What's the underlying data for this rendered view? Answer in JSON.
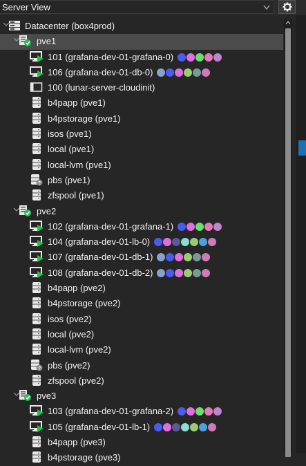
{
  "header": {
    "view_label": "Server View"
  },
  "tree": [
    {
      "label": "Datacenter (box4prod)",
      "icon": "datacenter-icon",
      "level": 0,
      "toggle": true,
      "selected": false
    },
    {
      "label": "pve1",
      "icon": "node-online-icon",
      "level": 1,
      "toggle": true,
      "selected": true
    },
    {
      "label": "101 (grafana-dev-01-grafana-0)",
      "icon": "vm-running-icon",
      "level": 2,
      "tags": [
        "#4a5cf0",
        "#e06ee0",
        "#6ae06a",
        "#e07ab8",
        "#c083d0"
      ]
    },
    {
      "label": "106 (grafana-dev-01-db-0)",
      "icon": "vm-running-icon",
      "level": 2,
      "tags": [
        "#8aa0d0",
        "#4a5cf0",
        "#e06ee0",
        "#9acd72",
        "#7a9a98",
        "#d27ab8"
      ]
    },
    {
      "label": "100 (lunar-server-cloudinit)",
      "icon": "template-icon",
      "level": 2
    },
    {
      "label": "b4papp (pve1)",
      "icon": "storage-icon",
      "level": 2
    },
    {
      "label": "b4pstorage (pve1)",
      "icon": "storage-icon",
      "level": 2
    },
    {
      "label": "isos (pve1)",
      "icon": "storage-icon",
      "level": 2
    },
    {
      "label": "local (pve1)",
      "icon": "storage-icon",
      "level": 2
    },
    {
      "label": "local-lvm (pve1)",
      "icon": "storage-icon",
      "level": 2
    },
    {
      "label": "pbs (pve1)",
      "icon": "storage-unknown-icon",
      "level": 2
    },
    {
      "label": "zfspool (pve1)",
      "icon": "storage-icon",
      "level": 2
    },
    {
      "label": "pve2",
      "icon": "node-online-icon",
      "level": 1,
      "toggle": true,
      "selected": false
    },
    {
      "label": "102 (grafana-dev-01-grafana-1)",
      "icon": "vm-running-icon",
      "level": 2,
      "tags": [
        "#4a5cf0",
        "#e06ee0",
        "#6ae06a",
        "#e07ab8",
        "#c083d0"
      ]
    },
    {
      "label": "104 (grafana-dev-01-lb-0)",
      "icon": "vm-running-icon",
      "level": 2,
      "tags": [
        "#4a5cf0",
        "#e06ee0",
        "#5a5a9a",
        "#8ae0d0",
        "#9acd72",
        "#4aa0e0",
        "#d27ab8"
      ]
    },
    {
      "label": "107 (grafana-dev-01-db-1)",
      "icon": "vm-running-icon",
      "level": 2,
      "tags": [
        "#8aa0d0",
        "#4a5cf0",
        "#e06ee0",
        "#9acd72",
        "#7a9a98",
        "#d27ab8"
      ]
    },
    {
      "label": "108 (grafana-dev-01-db-2)",
      "icon": "vm-running-icon",
      "level": 2,
      "tags": [
        "#8aa0d0",
        "#4a5cf0",
        "#e06ee0",
        "#9acd72",
        "#7a9a98",
        "#d27ab8"
      ]
    },
    {
      "label": "b4papp (pve2)",
      "icon": "storage-icon",
      "level": 2
    },
    {
      "label": "b4pstorage (pve2)",
      "icon": "storage-icon",
      "level": 2
    },
    {
      "label": "isos (pve2)",
      "icon": "storage-icon",
      "level": 2
    },
    {
      "label": "local (pve2)",
      "icon": "storage-icon",
      "level": 2
    },
    {
      "label": "local-lvm (pve2)",
      "icon": "storage-icon",
      "level": 2
    },
    {
      "label": "pbs (pve2)",
      "icon": "storage-unknown-icon",
      "level": 2
    },
    {
      "label": "zfspool (pve2)",
      "icon": "storage-icon",
      "level": 2
    },
    {
      "label": "pve3",
      "icon": "node-online-icon",
      "level": 1,
      "toggle": true,
      "selected": false
    },
    {
      "label": "103 (grafana-dev-01-grafana-2)",
      "icon": "vm-running-icon",
      "level": 2,
      "tags": [
        "#4a5cf0",
        "#e06ee0",
        "#6ae06a",
        "#e07ab8",
        "#c083d0"
      ]
    },
    {
      "label": "105 (grafana-dev-01-lb-1)",
      "icon": "vm-running-icon",
      "level": 2,
      "tags": [
        "#4a5cf0",
        "#e06ee0",
        "#5a5a9a",
        "#8ae0d0",
        "#9acd72",
        "#4aa0e0",
        "#d27ab8"
      ]
    },
    {
      "label": "b4papp (pve3)",
      "icon": "storage-icon",
      "level": 2
    },
    {
      "label": "b4pstorage (pve3)",
      "icon": "storage-icon",
      "level": 2
    }
  ]
}
